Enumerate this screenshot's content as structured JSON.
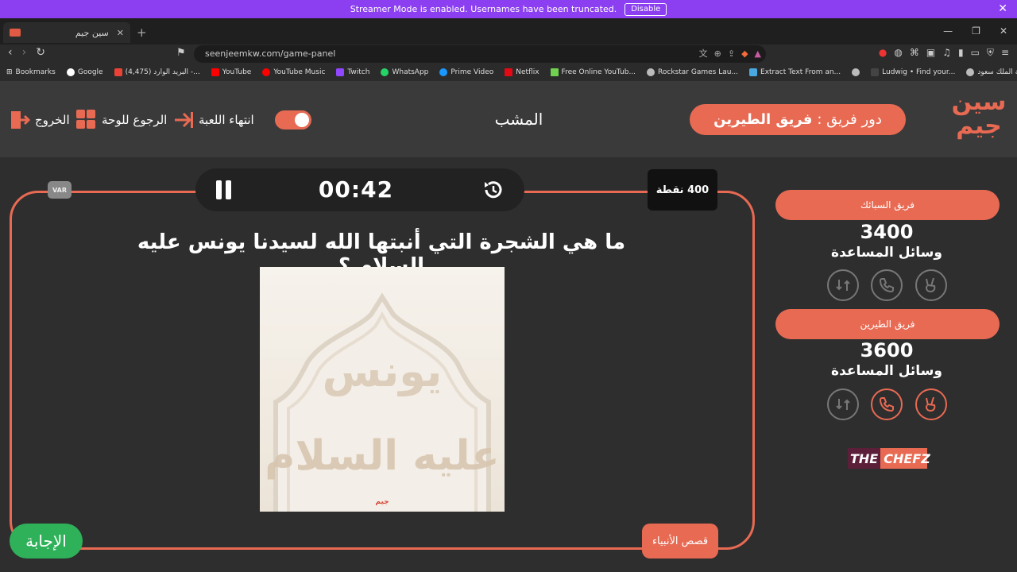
{
  "streamer": {
    "message": "Streamer Mode is enabled. Usernames have been truncated.",
    "disable": "Disable"
  },
  "browser": {
    "tab_title": "سين جيم",
    "url": "seenjeemkw.com/game-panel",
    "bookmarks": [
      "Bookmarks",
      "Google",
      "(4,475) البريد الوارد -...",
      "YouTube",
      "YouTube Music",
      "Twitch",
      "WhatsApp",
      "Prime Video",
      "Netflix",
      "Free Online YouTub...",
      "Rockstar Games Lau...",
      "Extract Text From an...",
      "",
      "Ludwig • Find your...",
      "جامعة الملك سعود ..."
    ]
  },
  "header": {
    "turn_prefix": "دور فريق :",
    "turn_team": "فريق الطيرين",
    "category": "المشب",
    "end_game": "انتهاء اللعبة",
    "back_to_board": "الرجوع للوحة",
    "exit": "الخروج",
    "logo_line1": "سين",
    "logo_line2": "جيم"
  },
  "game": {
    "timer": "00:42",
    "points": "400 نقطة",
    "var": "VAR",
    "question": "ما هي الشجرة التي أنبتها الله لسيدنا يونس عليه السلام ؟",
    "image_text_1": "يونس",
    "image_text_2": "عليه السلام",
    "answer_button": "الإجابة",
    "category_badge": "قصص الأنبياء"
  },
  "teams": [
    {
      "name": "فريق السبائك",
      "score": "3400",
      "aids_label": "وسائل المساعدة"
    },
    {
      "name": "فريق الطيرين",
      "score": "3600",
      "aids_label": "وسائل المساعدة"
    }
  ],
  "sponsor": {
    "the": "THE",
    "rest": "CHEFZ"
  },
  "colors": {
    "accent": "#e86a53",
    "green": "#2fb15a",
    "purple": "#8b3ff0"
  }
}
